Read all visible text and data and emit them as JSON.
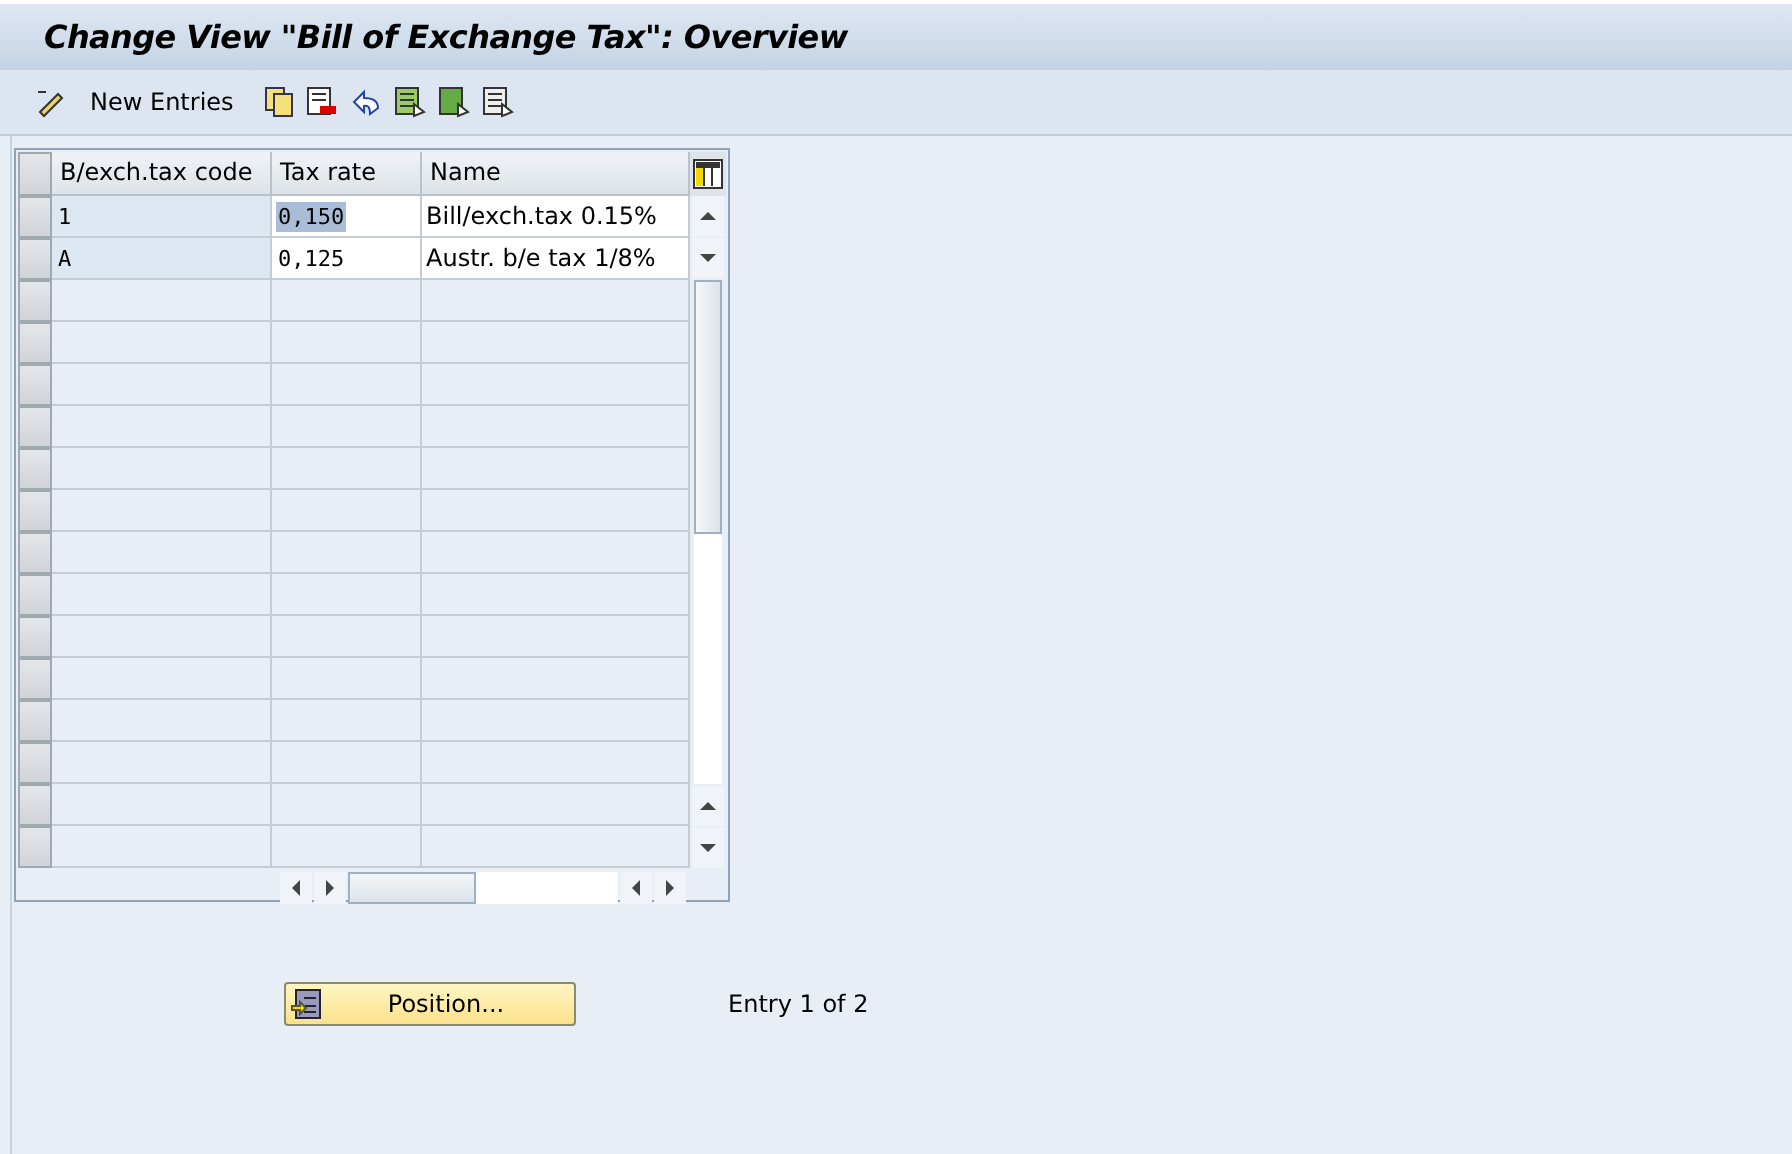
{
  "window": {
    "title": "Change View \"Bill of Exchange Tax\": Overview"
  },
  "toolbar": {
    "new_entries": "New Entries"
  },
  "table": {
    "columns": [
      "B/exch.tax code",
      "Tax rate",
      "Name"
    ],
    "rows": [
      {
        "code": "1",
        "rate": "0,150",
        "name": "Bill/exch.tax 0.15%",
        "selected": true
      },
      {
        "code": "A",
        "rate": "0,125",
        "name": "Austr. b/e tax 1/8%",
        "selected": false
      }
    ]
  },
  "position_button": "Position...",
  "entry_info": "Entry 1 of 2"
}
